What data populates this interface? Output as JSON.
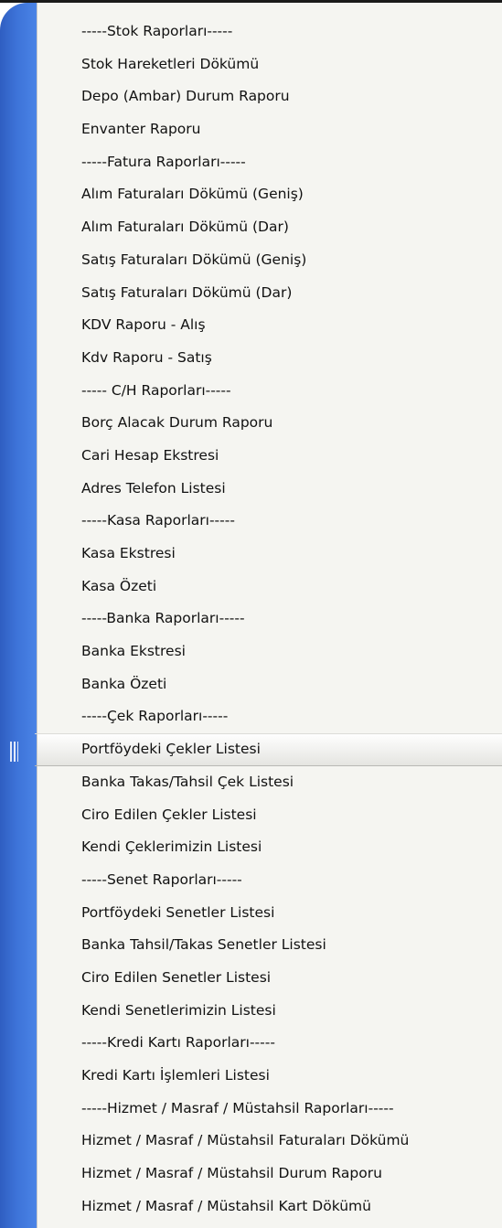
{
  "menu": {
    "items": [
      {
        "label": "-----Stok Raporları-----",
        "type": "separator"
      },
      {
        "label": "Stok Hareketleri Dökümü",
        "type": "item"
      },
      {
        "label": "Depo (Ambar) Durum Raporu",
        "type": "item"
      },
      {
        "label": "Envanter Raporu",
        "type": "item"
      },
      {
        "label": "-----Fatura Raporları-----",
        "type": "separator"
      },
      {
        "label": "Alım Faturaları Dökümü (Geniş)",
        "type": "item"
      },
      {
        "label": "Alım Faturaları Dökümü (Dar)",
        "type": "item"
      },
      {
        "label": "Satış Faturaları Dökümü (Geniş)",
        "type": "item"
      },
      {
        "label": "Satış Faturaları Dökümü (Dar)",
        "type": "item"
      },
      {
        "label": "KDV Raporu - Alış",
        "type": "item"
      },
      {
        "label": "Kdv Raporu - Satış",
        "type": "item"
      },
      {
        "label": "----- C/H Raporları-----",
        "type": "separator"
      },
      {
        "label": "Borç Alacak Durum Raporu",
        "type": "item"
      },
      {
        "label": "Cari Hesap Ekstresi",
        "type": "item"
      },
      {
        "label": "Adres Telefon Listesi",
        "type": "item"
      },
      {
        "label": "-----Kasa Raporları-----",
        "type": "separator"
      },
      {
        "label": "Kasa Ekstresi",
        "type": "item"
      },
      {
        "label": "Kasa Özeti",
        "type": "item"
      },
      {
        "label": "-----Banka Raporları-----",
        "type": "separator"
      },
      {
        "label": "Banka Ekstresi",
        "type": "item"
      },
      {
        "label": "Banka Özeti",
        "type": "item"
      },
      {
        "label": "-----Çek Raporları-----",
        "type": "separator"
      },
      {
        "label": "Portföydeki Çekler Listesi",
        "type": "item",
        "highlighted": true
      },
      {
        "label": "Banka Takas/Tahsil Çek Listesi",
        "type": "item"
      },
      {
        "label": "Ciro Edilen Çekler Listesi",
        "type": "item"
      },
      {
        "label": "Kendi Çeklerimizin Listesi",
        "type": "item"
      },
      {
        "label": "-----Senet Raporları-----",
        "type": "separator"
      },
      {
        "label": "Portföydeki Senetler Listesi",
        "type": "item"
      },
      {
        "label": "Banka Tahsil/Takas Senetler Listesi",
        "type": "item"
      },
      {
        "label": "Ciro Edilen Senetler Listesi",
        "type": "item"
      },
      {
        "label": "Kendi Senetlerimizin Listesi",
        "type": "item"
      },
      {
        "label": "-----Kredi Kartı Raporları-----",
        "type": "separator"
      },
      {
        "label": "Kredi Kartı İşlemleri Listesi",
        "type": "item"
      },
      {
        "label": "-----Hizmet / Masraf / Müstahsil Raporları-----",
        "type": "separator"
      },
      {
        "label": "Hizmet / Masraf / Müstahsil Faturaları Dökümü",
        "type": "item"
      },
      {
        "label": "Hizmet / Masraf / Müstahsil Durum Raporu",
        "type": "item"
      },
      {
        "label": "Hizmet / Masraf / Müstahsil Kart Dökümü",
        "type": "item"
      }
    ]
  },
  "colors": {
    "strip": "#3d73d8",
    "panel": "#f5f5f1",
    "text": "#111111"
  }
}
